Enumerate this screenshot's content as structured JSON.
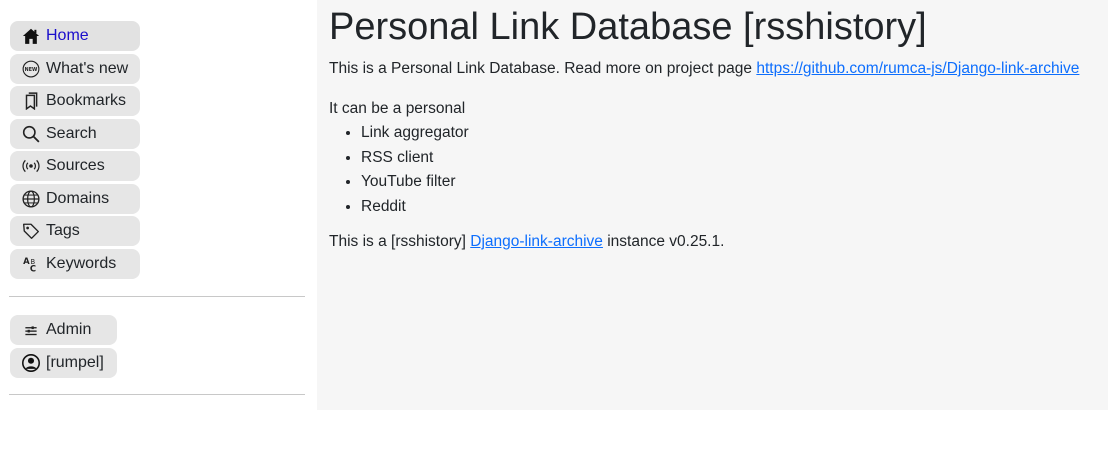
{
  "sidebar": {
    "items": [
      {
        "label": "Home",
        "icon": "home-icon",
        "active": true
      },
      {
        "label": "What's new",
        "icon": "new-badge-icon"
      },
      {
        "label": "Bookmarks",
        "icon": "bookmarks-icon"
      },
      {
        "label": "Search",
        "icon": "search-icon"
      },
      {
        "label": "Sources",
        "icon": "broadcast-icon"
      },
      {
        "label": "Domains",
        "icon": "globe-icon"
      },
      {
        "label": "Tags",
        "icon": "tag-icon"
      },
      {
        "label": "Keywords",
        "icon": "keywords-icon"
      }
    ],
    "admin": {
      "label": "Admin",
      "icon": "sliders-icon"
    },
    "user": {
      "label": "[rumpel]",
      "icon": "user-circle-icon"
    }
  },
  "main": {
    "title": "Personal Link Database [rsshistory]",
    "intro_text": "This is a Personal Link Database. Read more on project page ",
    "project_url": "https://github.com/rumca-js/Django-link-archive",
    "lead": "It can be a personal",
    "features": [
      "Link aggregator",
      "RSS client",
      "YouTube filter",
      "Reddit"
    ],
    "footer_prefix": "This is a [rsshistory] ",
    "footer_link": "Django-link-archive",
    "footer_suffix": " instance v0.25.1."
  },
  "colors": {
    "active_nav": "#1a0dcc",
    "link": "#0d6efd",
    "nav_bg": "#e6e6e6",
    "main_bg": "#f6f6f6"
  }
}
